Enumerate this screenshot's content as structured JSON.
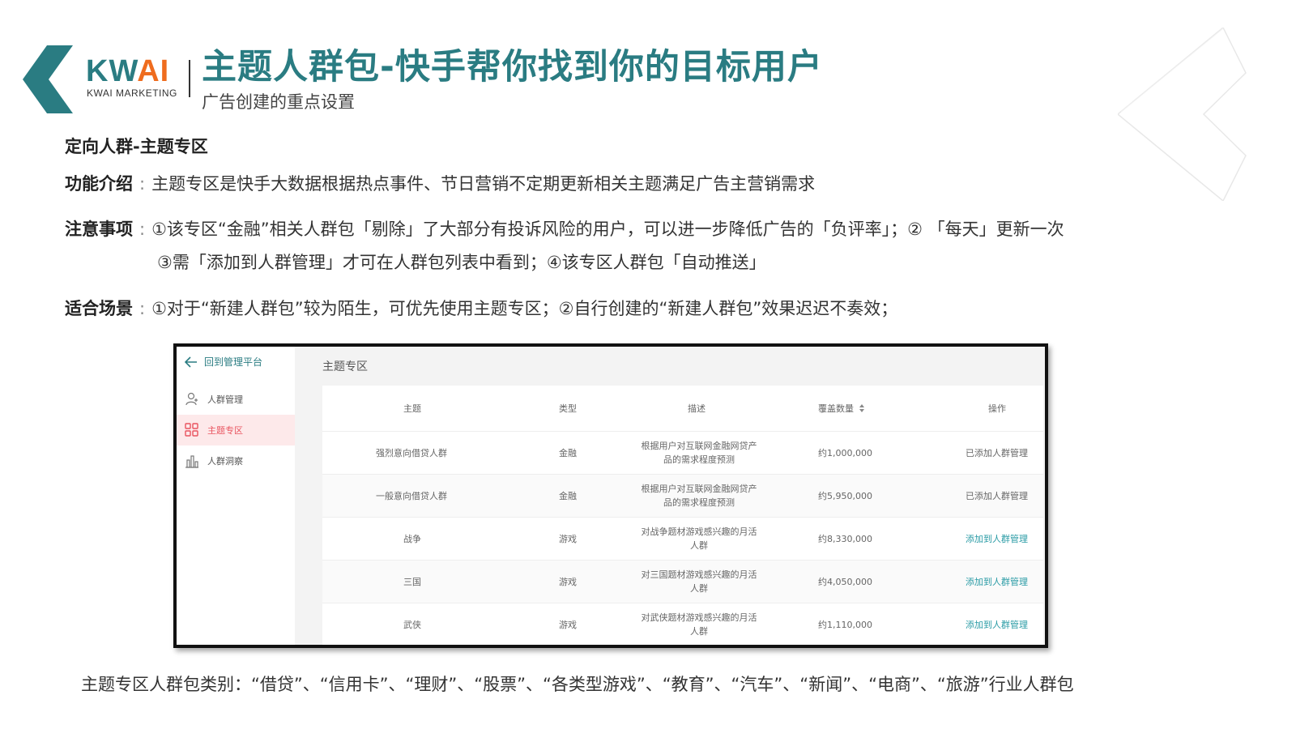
{
  "brand": {
    "logo_text_k": "KW",
    "logo_text_ai": "AI",
    "logo_sub": "KWAI MARKETING",
    "teal": "#2a7c82",
    "orange": "#ef6c1e"
  },
  "header": {
    "title": "主题人群包-快手帮你找到你的目标用户",
    "subtitle": "广告创建的重点设置"
  },
  "section": {
    "title": "定向人群-主题专区",
    "intro": {
      "label": "功能介绍",
      "text": "主题专区是快手大数据根据热点事件、节日营销不定期更新相关主题满足广告主营销需求"
    },
    "notes": {
      "label": "注意事项",
      "line1": "①该专区“金融”相关人群包「剔除」了大部分有投诉风险的用户，可以进一步降低广告的「负评率」；② 「每天」更新一次",
      "line2": "③需「添加到人群管理」才可在人群包列表中看到；④该专区人群包「自动推送」"
    },
    "scenario": {
      "label": "适合场景",
      "text": "①对于“新建人群包”较为陌生，可优先使用主题专区；②自行创建的“新建人群包”效果迟迟不奏效；"
    },
    "separator": ":"
  },
  "app": {
    "back_label": "回到管理平台",
    "sidebar": [
      {
        "label": "人群管理",
        "icon": "user-add-icon"
      },
      {
        "label": "主题专区",
        "icon": "grid-icon",
        "active": true
      },
      {
        "label": "人群洞察",
        "icon": "bar-chart-icon"
      }
    ],
    "content_title": "主题专区",
    "columns": [
      "主题",
      "类型",
      "描述",
      "覆盖数量",
      "操作"
    ],
    "rows": [
      {
        "theme": "强烈意向借贷人群",
        "type": "金融",
        "desc": "根据用户对互联网金融网贷产品的需求程度预测",
        "coverage": "约1,000,000",
        "action": "已添加人群管理",
        "added": true
      },
      {
        "theme": "一般意向借贷人群",
        "type": "金融",
        "desc": "根据用户对互联网金融网贷产品的需求程度预测",
        "coverage": "约5,950,000",
        "action": "已添加人群管理",
        "added": true
      },
      {
        "theme": "战争",
        "type": "游戏",
        "desc": "对战争题材游戏感兴趣的月活人群",
        "coverage": "约8,330,000",
        "action": "添加到人群管理",
        "added": false
      },
      {
        "theme": "三国",
        "type": "游戏",
        "desc": "对三国题材游戏感兴趣的月活人群",
        "coverage": "约4,050,000",
        "action": "添加到人群管理",
        "added": false
      },
      {
        "theme": "武侠",
        "type": "游戏",
        "desc": "对武侠题材游戏感兴趣的月活人群",
        "coverage": "约1,110,000",
        "action": "添加到人群管理",
        "added": false
      }
    ]
  },
  "caption": "主题专区人群包类别：“借贷”、“信用卡”、“理财”、“股票”、“各类型游戏”、“教育”、“汽车”、“新闻”、“电商”、“旅游”行业人群包"
}
